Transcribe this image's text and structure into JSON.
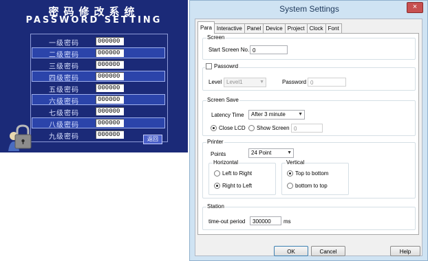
{
  "hmi": {
    "title_cn": "密码修改系统",
    "title_en": "PASSWORD SETTING",
    "rows": [
      {
        "label": "一级密码",
        "value": "000000"
      },
      {
        "label": "二级密码",
        "value": "000000"
      },
      {
        "label": "三级密码",
        "value": "000000"
      },
      {
        "label": "四级密码",
        "value": "000000"
      },
      {
        "label": "五级密码",
        "value": "000000"
      },
      {
        "label": "六级密码",
        "value": "000000"
      },
      {
        "label": "七级密码",
        "value": "000000"
      },
      {
        "label": "八级密码",
        "value": "000000"
      },
      {
        "label": "九级密码",
        "value": "000000"
      }
    ],
    "return_label": "返回",
    "icon": "lock-icon"
  },
  "dialog": {
    "title": "System Settings",
    "close": "×",
    "tabs": [
      "Para",
      "Interactive",
      "Panel",
      "Device",
      "Project",
      "Clock",
      "Font"
    ],
    "active_tab": "Para",
    "screen": {
      "group": "Screen",
      "start_label": "Start Screen No.",
      "start_value": "0"
    },
    "password": {
      "check_label": "Passowrd",
      "checked": false,
      "level_label": "Level",
      "level_value": "Level1",
      "password_label": "Password",
      "password_value": "0"
    },
    "screen_save": {
      "group": "Screen Save",
      "latency_label": "Latency Time",
      "latency_value": "After 3 minute",
      "close_lcd": "Close LCD",
      "show_screen": "Show Screen",
      "show_value": "0",
      "selected": "Close LCD"
    },
    "printer": {
      "group": "Printer",
      "points_label": "Points",
      "points_value": "24 Point",
      "horizontal": "Horizontal",
      "left_to_right": "Left to Right",
      "right_to_left": "Right to Left",
      "vertical": "Vertical",
      "top_to_bottom": "Top to bottom",
      "bottom_to_top": "bottom to top",
      "h_selected": "Right to Left",
      "v_selected": "Top to bottom"
    },
    "station": {
      "group": "Station",
      "timeout_label": "time-out period",
      "timeout_value": "300000",
      "unit": "ms"
    },
    "buttons": {
      "ok": "OK",
      "cancel": "Cancel",
      "help": "Help"
    }
  },
  "colors": {
    "hmi_bg": "#1b2a78",
    "dialog_frame": "#cfe3f3",
    "close": "#c75050"
  }
}
